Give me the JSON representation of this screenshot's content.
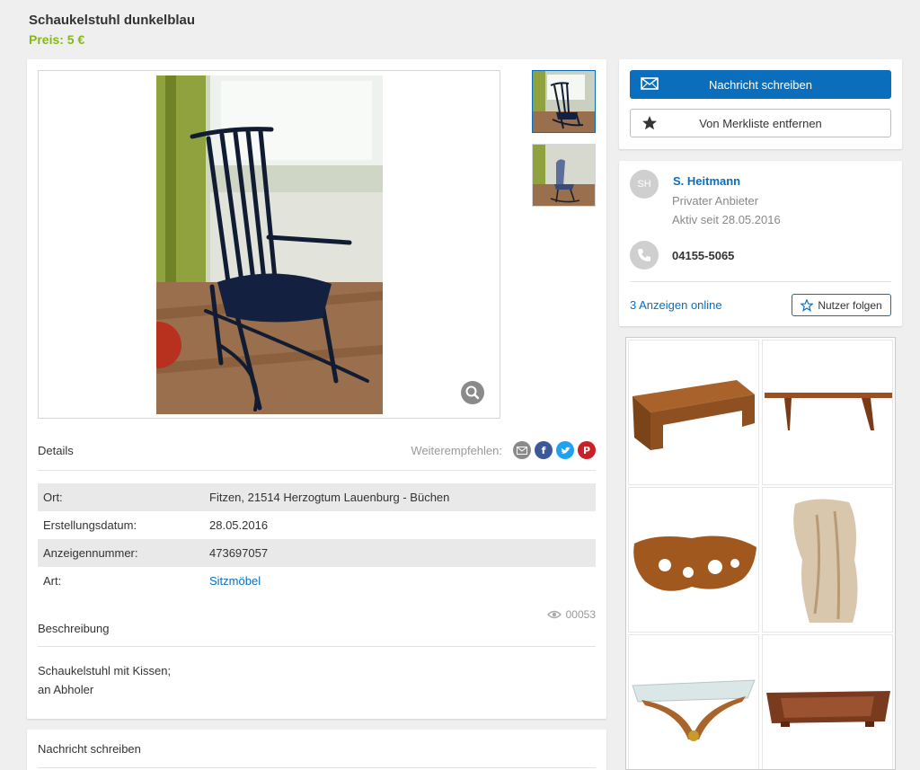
{
  "listing": {
    "title": "Schaukelstuhl dunkelblau",
    "price": "Preis: 5 €"
  },
  "details": {
    "heading": "Details",
    "share_label": "Weiterempfehlen:",
    "share_icons": [
      "email-icon",
      "facebook-icon",
      "twitter-icon",
      "pinterest-icon"
    ],
    "rows": [
      {
        "key": "Ort:",
        "value": "Fitzen, 21514 Herzogtum Lauenburg - Büchen"
      },
      {
        "key": "Erstellungsdatum:",
        "value": "28.05.2016"
      },
      {
        "key": "Anzeigennummer:",
        "value": "473697057"
      },
      {
        "key": "Art:",
        "value": "Sitzmöbel"
      }
    ],
    "views": "00053"
  },
  "description": {
    "heading": "Beschreibung",
    "line1": "Schaukelstuhl mit Kissen;",
    "line2": "an Abholer"
  },
  "message_section": {
    "heading": "Nachricht schreiben"
  },
  "actions": {
    "message_label": "Nachricht schreiben",
    "watchlist_label": "Von Merkliste entfernen"
  },
  "seller": {
    "initials": "SH",
    "name": "S. Heitmann",
    "type": "Privater Anbieter",
    "active_since": "Aktiv seit 28.05.2016",
    "phone": "04155-5065",
    "ads_online": "3 Anzeigen online",
    "follow_label": "Nutzer folgen"
  },
  "colors": {
    "accent_blue": "#0a6ebd",
    "price_green": "#86b817"
  }
}
